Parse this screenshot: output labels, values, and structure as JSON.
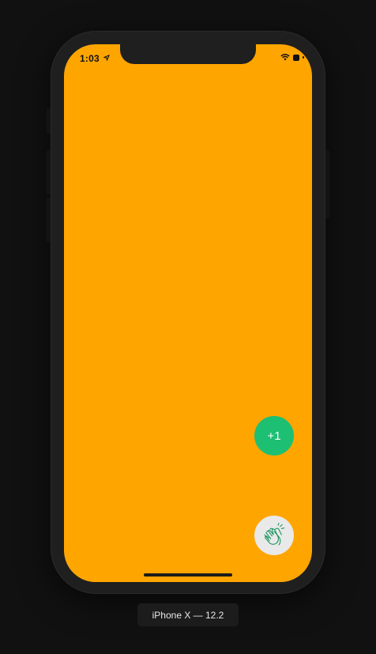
{
  "status_bar": {
    "time": "1:03"
  },
  "counter": {
    "label": "+1"
  },
  "clap": {
    "icon": "clap-icon"
  },
  "device": {
    "label": "iPhone X — 12.2"
  },
  "colors": {
    "screen_background": "#FFA500",
    "counter_bubble": "#1DBF73",
    "clap_button": "#E9E9E9",
    "clap_stroke": "#0E8F56",
    "desktop_background": "#111111"
  }
}
